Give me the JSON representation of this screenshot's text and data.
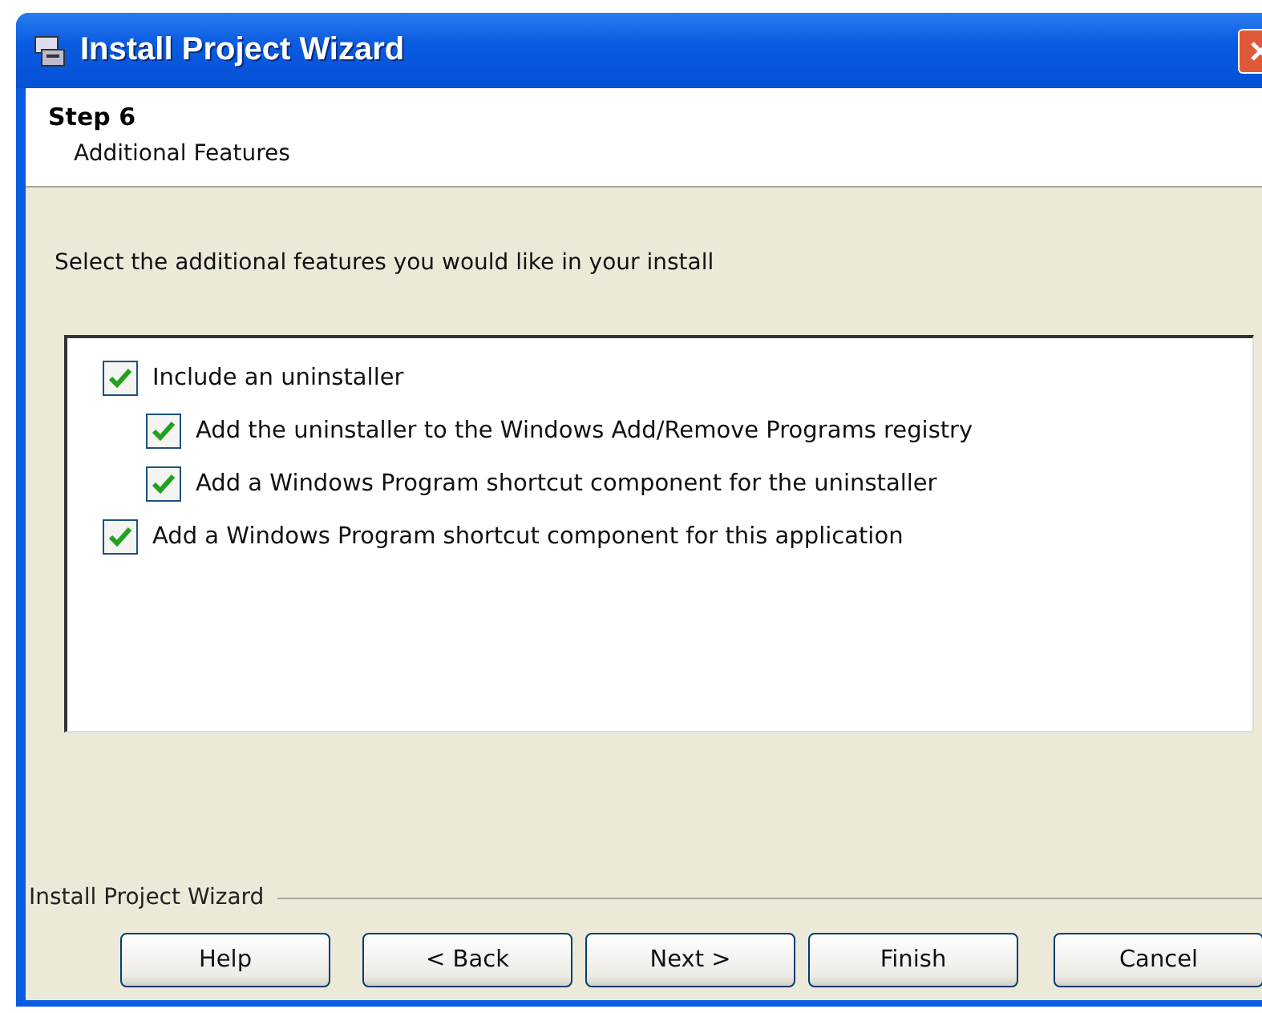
{
  "window": {
    "title": "Install Project Wizard"
  },
  "header": {
    "step": "Step 6",
    "subtitle": "Additional Features"
  },
  "instruction": "Select the additional features you would like in your install",
  "features": [
    {
      "label": "Include an uninstaller",
      "checked": true,
      "children": [
        {
          "label": "Add the uninstaller to the Windows Add/Remove Programs registry",
          "checked": true
        },
        {
          "label": "Add a Windows Program shortcut component for the uninstaller",
          "checked": true
        }
      ]
    },
    {
      "label": "Add a Windows Program shortcut component for this application",
      "checked": true
    }
  ],
  "footer_label": "Install Project Wizard",
  "buttons": [
    "Help",
    "< Back",
    "Next >",
    "Finish",
    "Cancel"
  ]
}
